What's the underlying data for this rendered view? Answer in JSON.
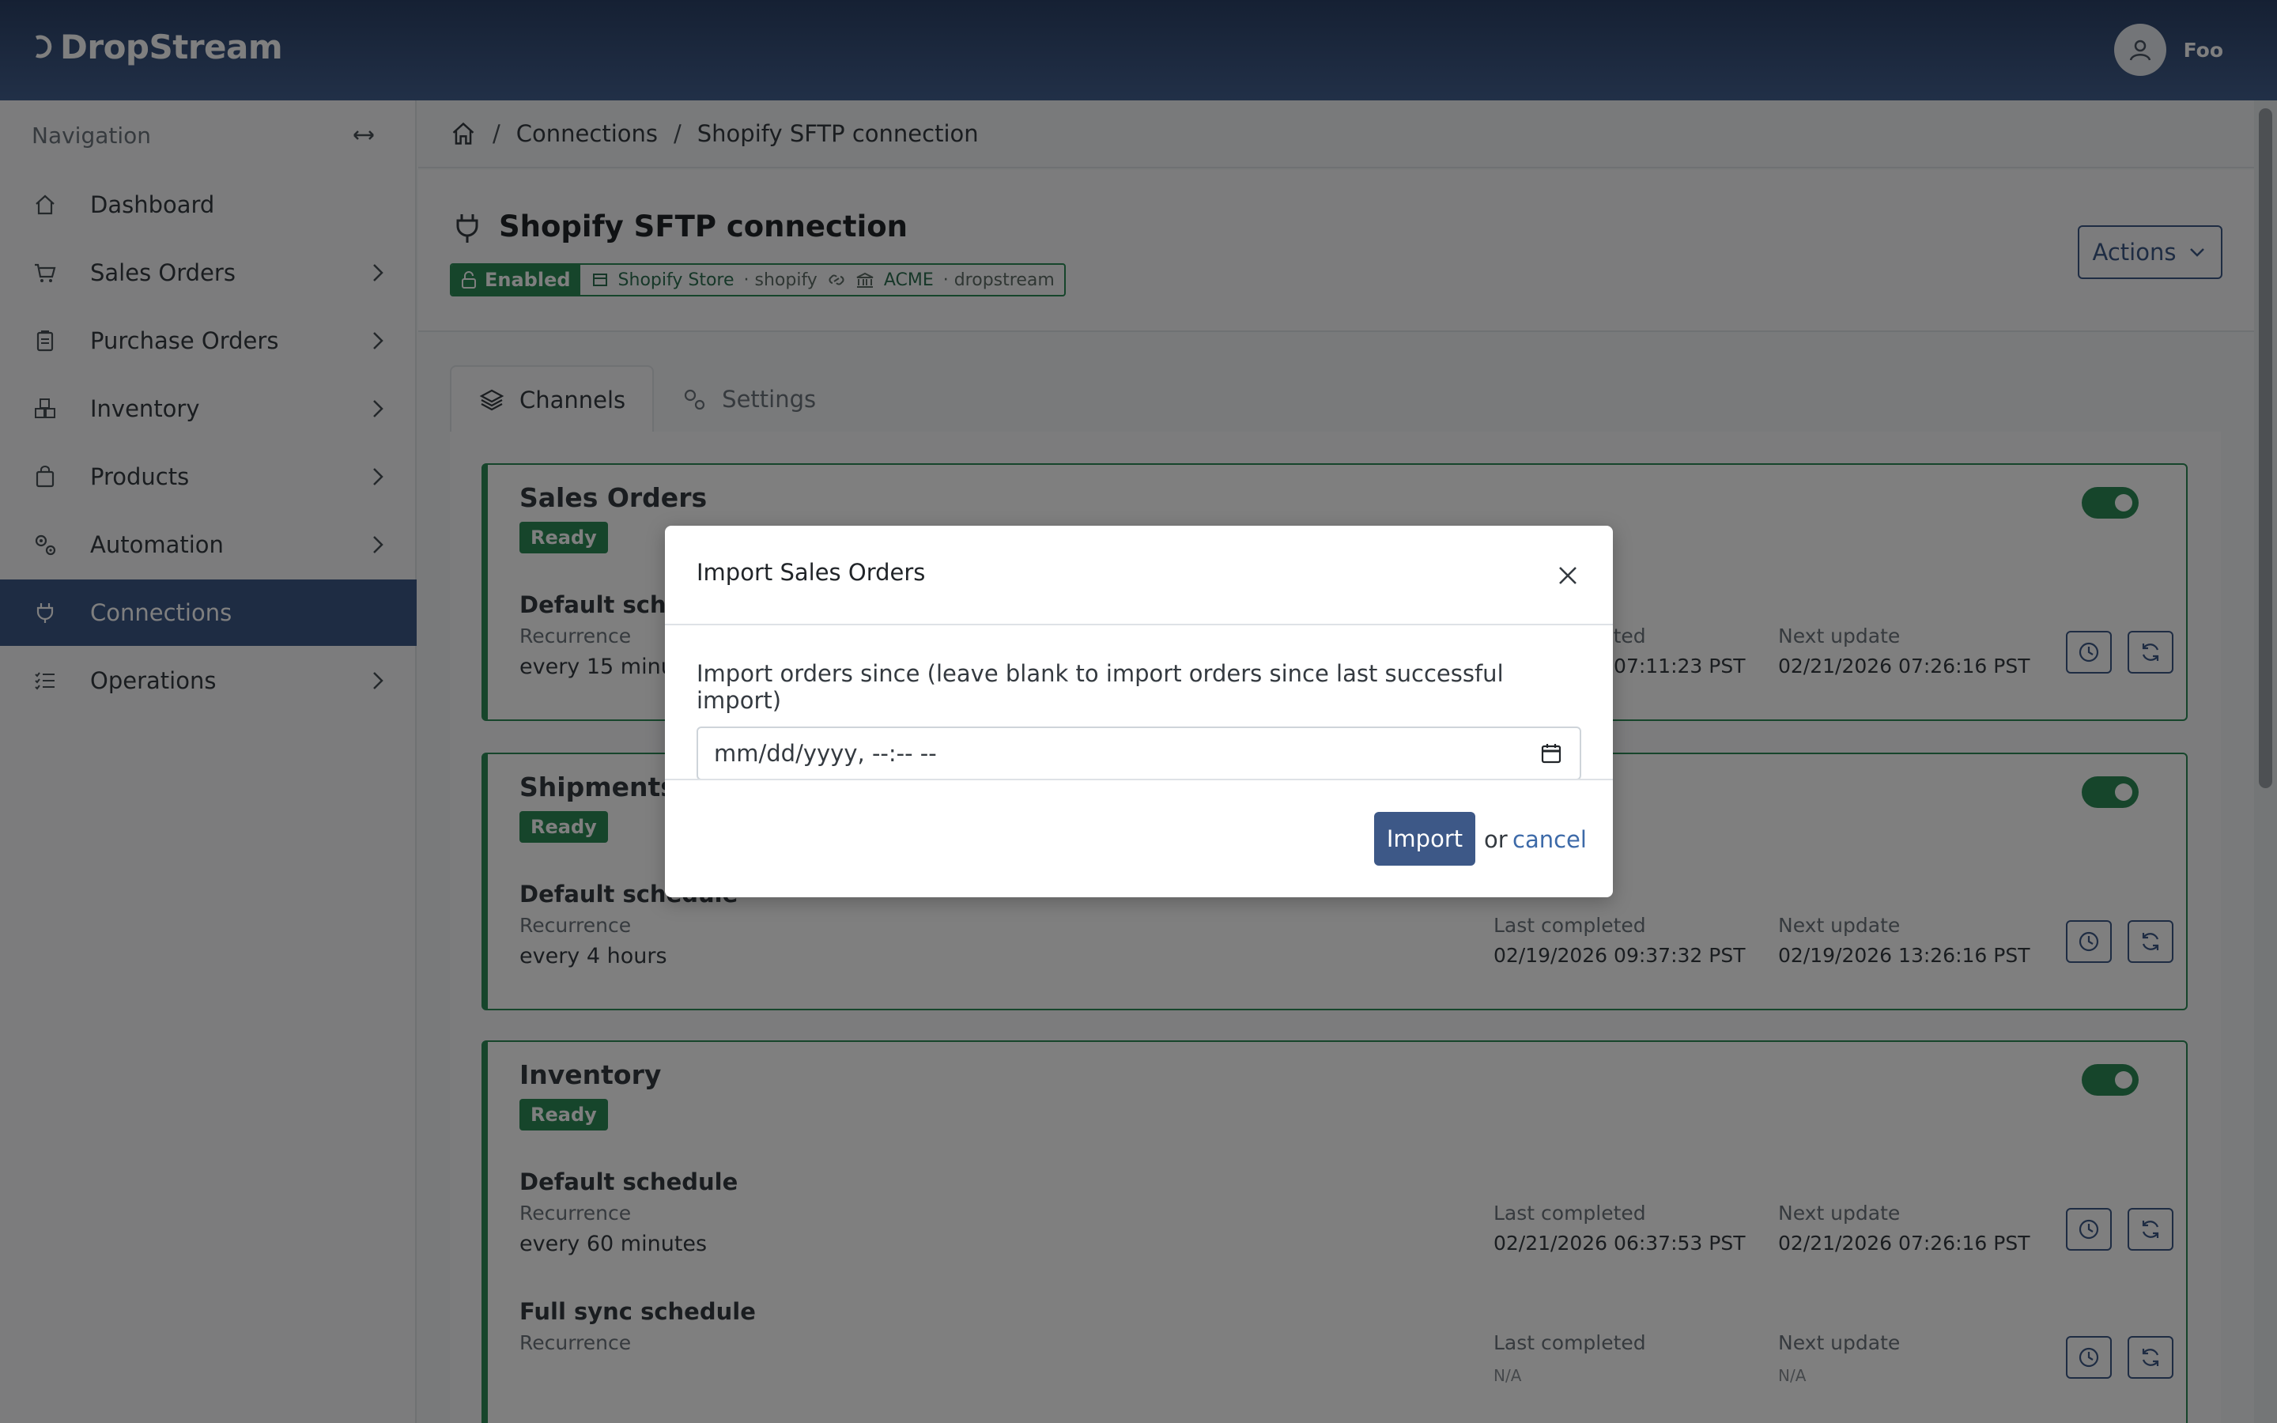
{
  "app": {
    "name": "DropStream"
  },
  "user": {
    "name": "Foo"
  },
  "sidebar": {
    "header": "Navigation",
    "items": [
      {
        "label": "Dashboard",
        "icon": "home-icon",
        "has_children": false
      },
      {
        "label": "Sales Orders",
        "icon": "cart-icon",
        "has_children": true
      },
      {
        "label": "Purchase Orders",
        "icon": "clipboard-icon",
        "has_children": true
      },
      {
        "label": "Inventory",
        "icon": "boxes-icon",
        "has_children": true
      },
      {
        "label": "Products",
        "icon": "bag-icon",
        "has_children": true
      },
      {
        "label": "Automation",
        "icon": "gears-icon",
        "has_children": true
      },
      {
        "label": "Connections",
        "icon": "plug-icon",
        "has_children": false,
        "active": true
      },
      {
        "label": "Operations",
        "icon": "list-icon",
        "has_children": true
      }
    ]
  },
  "breadcrumb": {
    "items": [
      "Connections",
      "Shopify SFTP connection"
    ]
  },
  "page": {
    "title": "Shopify SFTP connection",
    "status": "Enabled",
    "store_label": "Shopify Store",
    "store_type": "· shopify",
    "account_label": "ACME",
    "account_type": "· dropstream",
    "actions_label": "Actions"
  },
  "tabs": [
    {
      "label": "Channels",
      "active": true
    },
    {
      "label": "Settings",
      "active": false
    }
  ],
  "channels": [
    {
      "title": "Sales Orders",
      "status": "Ready",
      "enabled": true,
      "schedules": [
        {
          "title": "Default schedule",
          "recurrence_label": "Recurrence",
          "recurrence": "every 15 minutes",
          "last_completed_label": "Last completed",
          "last_completed": "02/21/2026 07:11:23 PST",
          "next_update_label": "Next update",
          "next_update": "02/21/2026 07:26:16 PST"
        }
      ]
    },
    {
      "title": "Shipments",
      "status": "Ready",
      "enabled": true,
      "schedules": [
        {
          "title": "Default schedule",
          "recurrence_label": "Recurrence",
          "recurrence": "every 4 hours",
          "last_completed_label": "Last completed",
          "last_completed": "02/19/2026 09:37:32 PST",
          "next_update_label": "Next update",
          "next_update": "02/19/2026 13:26:16 PST"
        }
      ]
    },
    {
      "title": "Inventory",
      "status": "Ready",
      "enabled": true,
      "schedules": [
        {
          "title": "Default schedule",
          "recurrence_label": "Recurrence",
          "recurrence": "every 60 minutes",
          "last_completed_label": "Last completed",
          "last_completed": "02/21/2026 06:37:53 PST",
          "next_update_label": "Next update",
          "next_update": "02/21/2026 07:26:16 PST"
        },
        {
          "title": "Full sync schedule",
          "recurrence_label": "Recurrence",
          "recurrence": "",
          "last_completed_label": "Last completed",
          "last_completed": "N/A",
          "next_update_label": "Next update",
          "next_update": "N/A"
        }
      ]
    }
  ],
  "modal": {
    "title": "Import Sales Orders",
    "field_label": "Import orders since (leave blank to import orders since last successful import)",
    "field_placeholder": "mm/dd/yyyy, --:-- --",
    "import_label": "Import",
    "or_label": "or",
    "cancel_label": "cancel"
  },
  "colors": {
    "navbar": "#2b4167",
    "primary": "#3d5887",
    "success": "#2c8a57",
    "link": "#3d6aa8"
  }
}
